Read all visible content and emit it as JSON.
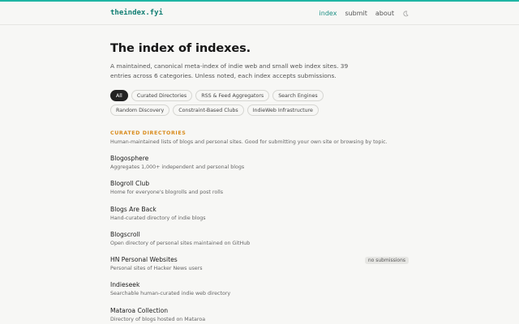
{
  "site": {
    "logo": "theindex.fyi"
  },
  "nav": {
    "items": [
      {
        "label": "index",
        "active": true
      },
      {
        "label": "submit"
      },
      {
        "label": "about"
      }
    ],
    "theme_toggle_icon": "moon-icon"
  },
  "page": {
    "title": "The index of indexes.",
    "intro": "A maintained, canonical meta-index of indie web and small web index sites. 39 entries across 6 categories. Unless noted, each index accepts submissions."
  },
  "filters": [
    "All",
    "Curated Directories",
    "RSS & Feed Aggregators",
    "Search Engines",
    "Random Discovery",
    "Constraint-Based Clubs",
    "IndieWeb Infrastructure"
  ],
  "section": {
    "title": "CURATED DIRECTORIES",
    "description": "Human-maintained lists of blogs and personal sites. Good for submitting your own site or browsing by topic.",
    "entries": [
      {
        "name": "Blogosphere",
        "desc": "Aggregates 1,000+ independent and personal blogs",
        "badge": ""
      },
      {
        "name": "Blogroll Club",
        "desc": "Home for everyone's blogrolls and post rolls",
        "badge": ""
      },
      {
        "name": "Blogs Are Back",
        "desc": "Hand-curated directory of indie blogs",
        "badge": ""
      },
      {
        "name": "Blogscroll",
        "desc": "Open directory of personal sites maintained on GitHub",
        "badge": ""
      },
      {
        "name": "HN Personal Websites",
        "desc": "Personal sites of Hacker News users",
        "badge": "no submissions"
      },
      {
        "name": "Indieseek",
        "desc": "Searchable human-curated indie web directory",
        "badge": ""
      },
      {
        "name": "Mataroa Collection",
        "desc": "Directory of blogs hosted on Mataroa",
        "badge": ""
      }
    ]
  },
  "colors": {
    "accent": "#1fb5a4",
    "logo": "#0f7d72",
    "section": "#d98b1c"
  }
}
